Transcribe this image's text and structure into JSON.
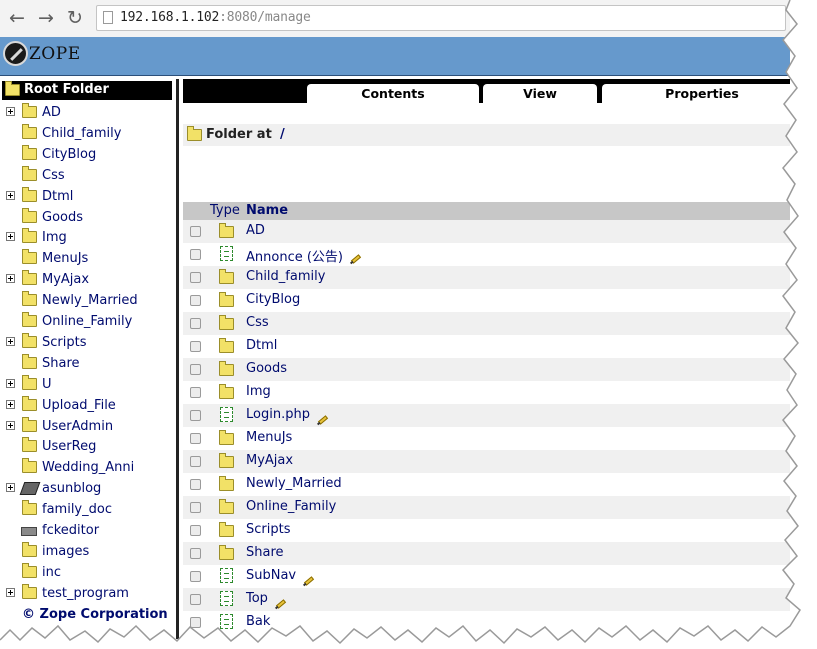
{
  "browser": {
    "url_host": "192.168.1.102",
    "url_path": ":8080/manage"
  },
  "banner": {
    "logo_text": "ZOPE"
  },
  "tree": {
    "root_label": "Root Folder",
    "items": [
      {
        "label": "AD",
        "expandable": true,
        "icon": "folder-icon"
      },
      {
        "label": "Child_family",
        "expandable": false,
        "icon": "folder-icon"
      },
      {
        "label": "CityBlog",
        "expandable": false,
        "icon": "folder-icon"
      },
      {
        "label": "Css",
        "expandable": false,
        "icon": "folder-icon"
      },
      {
        "label": "Dtml",
        "expandable": true,
        "icon": "folder-icon"
      },
      {
        "label": "Goods",
        "expandable": false,
        "icon": "folder-icon"
      },
      {
        "label": "Img",
        "expandable": true,
        "icon": "folder-icon"
      },
      {
        "label": "MenuJs",
        "expandable": false,
        "icon": "folder-icon"
      },
      {
        "label": "MyAjax",
        "expandable": true,
        "icon": "folder-icon"
      },
      {
        "label": "Newly_Married",
        "expandable": false,
        "icon": "folder-icon"
      },
      {
        "label": "Online_Family",
        "expandable": false,
        "icon": "folder-icon"
      },
      {
        "label": "Scripts",
        "expandable": true,
        "icon": "folder-icon"
      },
      {
        "label": "Share",
        "expandable": false,
        "icon": "folder-icon"
      },
      {
        "label": "U",
        "expandable": true,
        "icon": "folder-icon"
      },
      {
        "label": "Upload_File",
        "expandable": true,
        "icon": "folder-icon"
      },
      {
        "label": "UserAdmin",
        "expandable": true,
        "icon": "folder-icon"
      },
      {
        "label": "UserReg",
        "expandable": false,
        "icon": "folder-icon"
      },
      {
        "label": "Wedding_Anni",
        "expandable": false,
        "icon": "folder-icon"
      },
      {
        "label": "asunblog",
        "expandable": true,
        "icon": "disk-icon"
      },
      {
        "label": "family_doc",
        "expandable": false,
        "icon": "folder-icon"
      },
      {
        "label": "fckeditor",
        "expandable": false,
        "icon": "drive-icon"
      },
      {
        "label": "images",
        "expandable": false,
        "icon": "folder-icon"
      },
      {
        "label": "inc",
        "expandable": false,
        "icon": "folder-icon"
      },
      {
        "label": "test_program",
        "expandable": true,
        "icon": "folder-icon"
      }
    ],
    "footer": "© Zope Corporation"
  },
  "tabs": [
    {
      "label": "Contents"
    },
    {
      "label": "View"
    },
    {
      "label": "Properties"
    }
  ],
  "location": {
    "label": "Folder at",
    "root_link": "/"
  },
  "table": {
    "col_type": "Type",
    "col_name": "Name",
    "rows": [
      {
        "name": "AD",
        "icon": "folder-icon",
        "editable": false
      },
      {
        "name": "Annonce (公告)",
        "icon": "file-icon",
        "editable": true
      },
      {
        "name": "Child_family",
        "icon": "folder-icon",
        "editable": false
      },
      {
        "name": "CityBlog",
        "icon": "folder-icon",
        "editable": false
      },
      {
        "name": "Css",
        "icon": "folder-icon",
        "editable": false
      },
      {
        "name": "Dtml",
        "icon": "folder-icon",
        "editable": false
      },
      {
        "name": "Goods",
        "icon": "folder-icon",
        "editable": false
      },
      {
        "name": "Img",
        "icon": "folder-icon",
        "editable": false
      },
      {
        "name": "Login.php",
        "icon": "file-icon",
        "editable": true
      },
      {
        "name": "MenuJs",
        "icon": "folder-icon",
        "editable": false
      },
      {
        "name": "MyAjax",
        "icon": "folder-icon",
        "editable": false
      },
      {
        "name": "Newly_Married",
        "icon": "folder-icon",
        "editable": false
      },
      {
        "name": "Online_Family",
        "icon": "folder-icon",
        "editable": false
      },
      {
        "name": "Scripts",
        "icon": "folder-icon",
        "editable": false
      },
      {
        "name": "Share",
        "icon": "folder-icon",
        "editable": false
      },
      {
        "name": "SubNav",
        "icon": "file-icon",
        "editable": true
      },
      {
        "name": "Top",
        "icon": "file-icon",
        "editable": true
      },
      {
        "name": "Bak",
        "icon": "file-icon",
        "editable": false
      }
    ]
  },
  "colors": {
    "banner": "#6699cc",
    "link": "#000b6e",
    "row_alt": "#f0f0f0",
    "header_bg": "#c7c7c7"
  }
}
